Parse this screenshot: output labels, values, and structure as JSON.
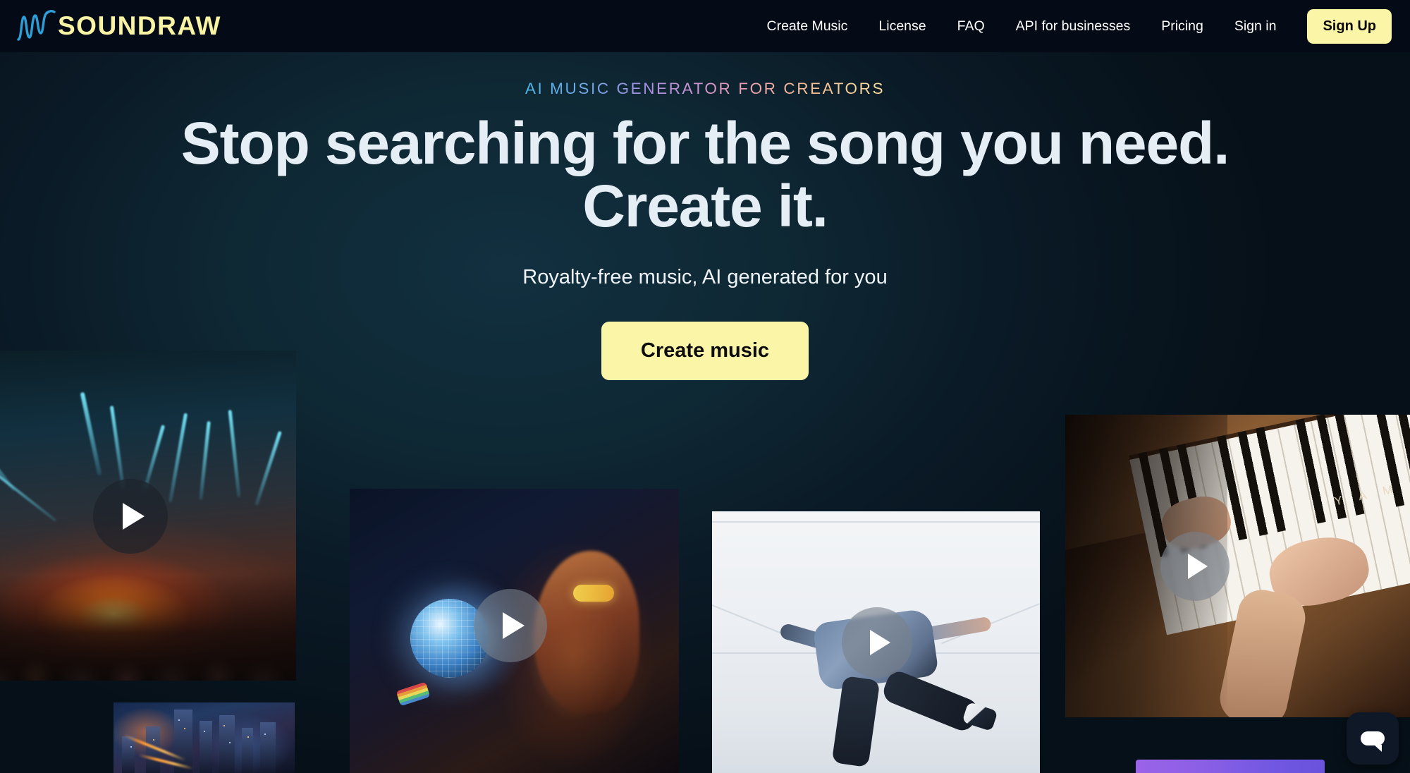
{
  "nav": {
    "logo": {
      "wordmark": "SOUNDRAW",
      "icon": "waveform-icon",
      "wordmark_color": "#f9f3a4",
      "wave_color": "#2d9fd8"
    },
    "links": [
      {
        "label": "Create Music"
      },
      {
        "label": "License"
      },
      {
        "label": "FAQ"
      },
      {
        "label": "API for businesses"
      },
      {
        "label": "Pricing"
      },
      {
        "label": "Sign in"
      }
    ],
    "signup_label": "Sign Up",
    "signup_bg": "#fbf5a8",
    "bar_bg": "#050b16"
  },
  "hero": {
    "eyebrow": "AI MUSIC GENERATOR FOR CREATORS",
    "headline": "Stop searching for the song you need. Create it.",
    "subhead": "Royalty-free music, AI generated for you",
    "cta_label": "Create music",
    "cta_bg": "#fbf5a8",
    "headline_color": "#e6eef5",
    "background_color": "#0e2733"
  },
  "media_cards": [
    {
      "name": "concert-lasers",
      "play_label": "play-icon"
    },
    {
      "name": "disco-ball-woman",
      "play_label": "play-icon"
    },
    {
      "name": "dancer-white-studio",
      "play_label": "play-icon"
    },
    {
      "name": "piano-hands",
      "play_label": "play-icon",
      "brand_text": "Y A M"
    },
    {
      "name": "night-cityscape"
    },
    {
      "name": "purple-card"
    }
  ],
  "chat": {
    "icon": "chat-bubble-icon",
    "bg": "#0f1826"
  }
}
